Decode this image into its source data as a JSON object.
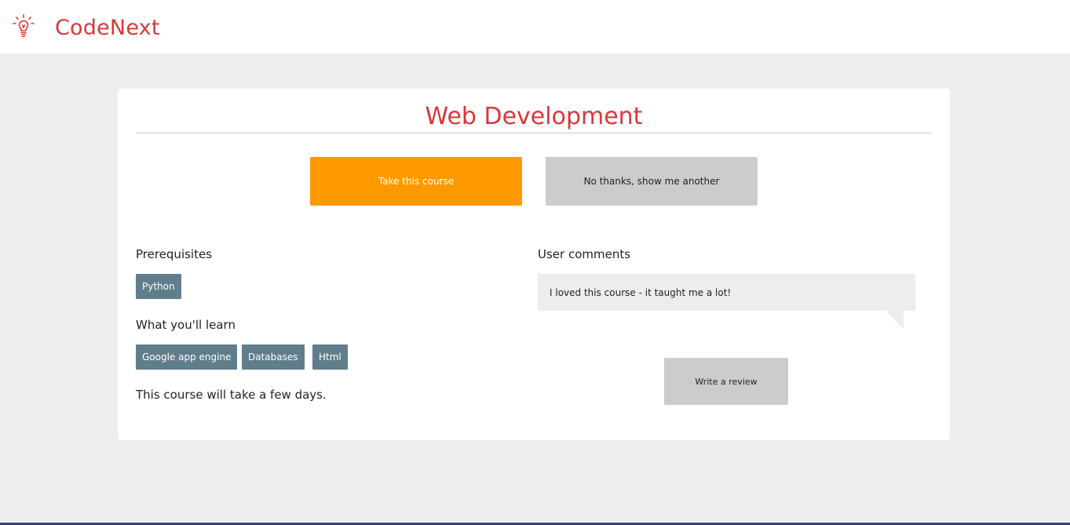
{
  "header": {
    "brand": "CodeNext",
    "logo_icon": "lightbulb-icon",
    "brand_color": "#d9383a"
  },
  "course": {
    "title": "Web Development",
    "take_label": "Take this course",
    "skip_label": "No thanks, show me another",
    "prerequisites_label": "Prerequisites",
    "prerequisites": [
      "Python"
    ],
    "learn_label": "What you'll learn",
    "learn_items": [
      "Google app engine",
      "Databases",
      "Html"
    ],
    "duration": "This course will take a few days.",
    "comments_label": "User comments",
    "comments": [
      "I loved this course - it taught me a lot!"
    ],
    "review_label": "Write a review"
  },
  "colors": {
    "accent": "#ff9900",
    "tag": "#607d8b",
    "neutral_button": "#cccccc",
    "background": "#ededed"
  }
}
